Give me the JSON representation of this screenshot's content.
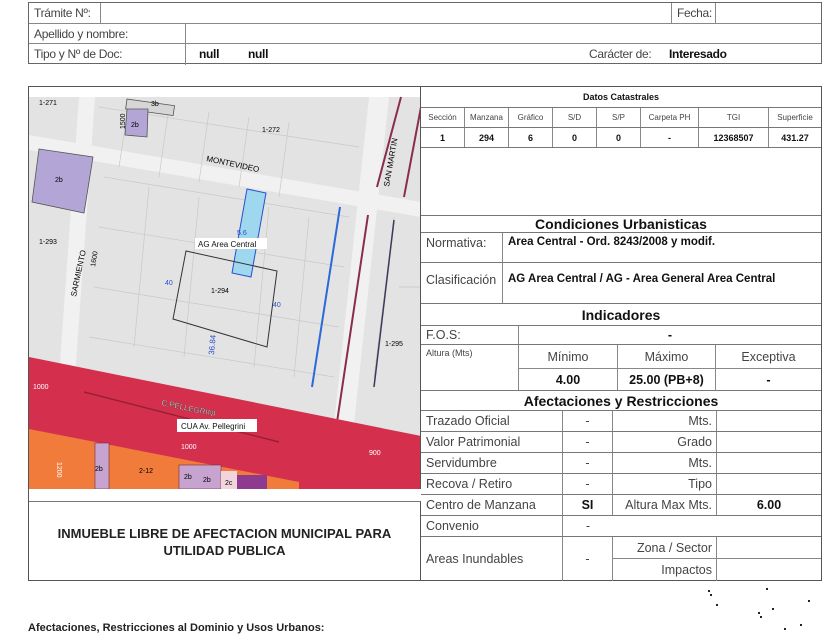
{
  "header": {
    "tramite_label": "Trámite Nº:",
    "tramite_value": "",
    "fecha_label": "Fecha:",
    "fecha_value": "",
    "apellido_label": "Apellido y nombre:",
    "apellido_value": "",
    "doc_label": "Tipo y Nº de Doc:",
    "doc_tipo": "null",
    "doc_numero": "null",
    "caracter_label": "Carácter de:",
    "caracter_value": "Interesado"
  },
  "map": {
    "labels": [
      "1-271",
      "3b",
      "2b",
      "1-272",
      "1500",
      "MONTEVIDEO",
      "SAN MARTIN",
      "2b",
      "1-293",
      "AG Area Central",
      "SARMIENTO",
      "1600",
      "40",
      "1-294",
      "40",
      "36.84",
      "1-295",
      "5.6",
      "1000",
      "C.PELLEGRINI",
      "CUA Av. Pellegrini",
      "1000",
      "900",
      "1200",
      "2b",
      "2-12",
      "2b",
      "2b",
      "2c"
    ]
  },
  "caption": "INMUEBLE LIBRE DE AFECTACION MUNICIPAL PARA UTILIDAD PUBLICA",
  "catastro": {
    "title": "Datos Catastrales",
    "headers": [
      "Sección",
      "Manzana",
      "Gráfico",
      "S/D",
      "S/P",
      "Carpeta PH",
      "TGI",
      "Superficie"
    ],
    "values": [
      "1",
      "294",
      "6",
      "0",
      "0",
      "-",
      "12368507",
      "431.27"
    ]
  },
  "condiciones": {
    "title": "Condiciones Urbanisticas",
    "normativa_label": "Normativa:",
    "normativa_value": "Area Central - Ord. 8243/2008 y modif.",
    "clasificacion_label": "Clasificación",
    "clasificacion_value": "AG Area Central / AG - Area General Area Central"
  },
  "indicadores": {
    "title": "Indicadores",
    "fos_label": "F.O.S:",
    "fos_value": "-",
    "altura_label": "Altura (Mts)",
    "min_label": "Mínimo",
    "max_label": "Máximo",
    "exc_label": "Exceptiva",
    "min_value": "4.00",
    "max_value": "25.00 (PB+8)",
    "exc_value": "-"
  },
  "afectaciones": {
    "title": "Afectaciones y Restricciones",
    "rows": [
      {
        "label": "Trazado Oficial",
        "value": "-",
        "sub": "Mts.",
        "sub_value": ""
      },
      {
        "label": "Valor Patrimonial",
        "value": "-",
        "sub": "Grado",
        "sub_value": ""
      },
      {
        "label": "Servidumbre",
        "value": "-",
        "sub": "Mts.",
        "sub_value": ""
      },
      {
        "label": "Recova / Retiro",
        "value": "-",
        "sub": "Tipo",
        "sub_value": ""
      },
      {
        "label": "Centro de Manzana",
        "value": "SI",
        "sub": "Altura Max Mts.",
        "sub_value": "6.00"
      }
    ],
    "convenio_label": "Convenio",
    "convenio_value": "-",
    "areas_label": "Areas Inundables",
    "areas_value": "-",
    "zona_label": "Zona / Sector",
    "impactos_label": "Impactos"
  },
  "footer": {
    "title": "Afectaciones, Restricciones al Dominio y Usos Urbanos:"
  },
  "colors": {
    "red_band": "#d4304e",
    "orange": "#f07b3a",
    "purple": "#b3a6d6",
    "highlight": "#9fd7ee"
  }
}
